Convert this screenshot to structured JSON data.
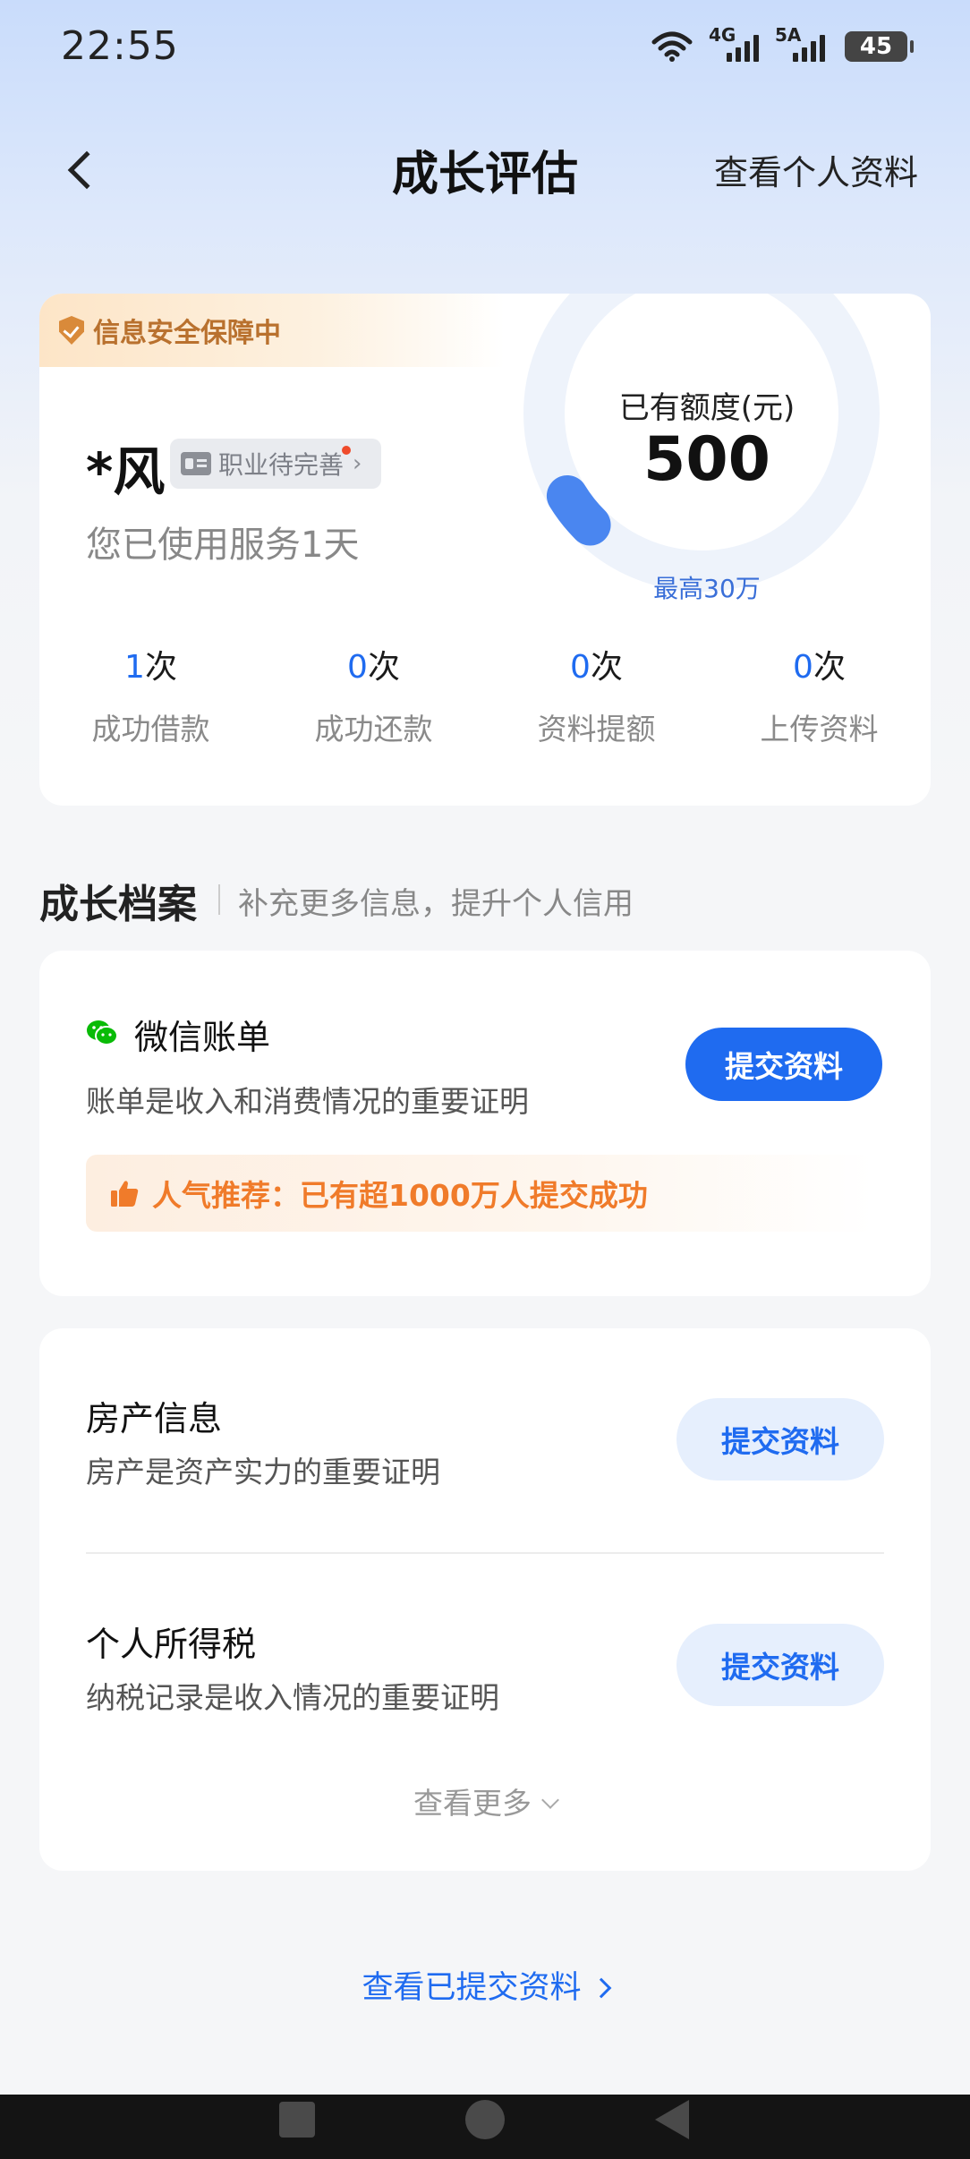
{
  "status_bar": {
    "time": "22:55",
    "network_1": "4G",
    "network_2": "5A",
    "battery": "45",
    "icons": [
      "wifi-icon",
      "signal-4g-icon",
      "signal-5a-icon",
      "battery-icon"
    ]
  },
  "header": {
    "title": "成长评估",
    "right_link": "查看个人资料",
    "back_icon": "back-arrow-icon"
  },
  "overview": {
    "security_badge": "信息安全保障中",
    "user_name": "*风",
    "job_tag": "职业待完善",
    "job_tag_chevron": "›",
    "days_used": "您已使用服务1天",
    "limit_label": "已有额度(元)",
    "limit_value": "500",
    "limit_max": "最高30万",
    "gauge_fraction": 0.05,
    "stats": [
      {
        "value": "1",
        "unit": "次",
        "label": "成功借款"
      },
      {
        "value": "0",
        "unit": "次",
        "label": "成功还款"
      },
      {
        "value": "0",
        "unit": "次",
        "label": "资料提额"
      },
      {
        "value": "0",
        "unit": "次",
        "label": "上传资料"
      }
    ]
  },
  "section": {
    "title": "成长档案",
    "subtitle": "补充更多信息，提升个人信用"
  },
  "wechat": {
    "title": "微信账单",
    "desc": "账单是收入和消费情况的重要证明",
    "button": "提交资料",
    "promo": "人气推荐：已有超1000万人提交成功"
  },
  "items": [
    {
      "title": "房产信息",
      "desc": "房产是资产实力的重要证明",
      "button": "提交资料"
    },
    {
      "title": "个人所得税",
      "desc": "纳税记录是收入情况的重要证明",
      "button": "提交资料"
    }
  ],
  "more_link": "查看更多",
  "submitted_link": "查看已提交资料",
  "colors": {
    "accent": "#1f6bf0",
    "promo_orange": "#f07b2a",
    "security_brown": "#b9712e",
    "wechat_green": "#09bb07"
  }
}
